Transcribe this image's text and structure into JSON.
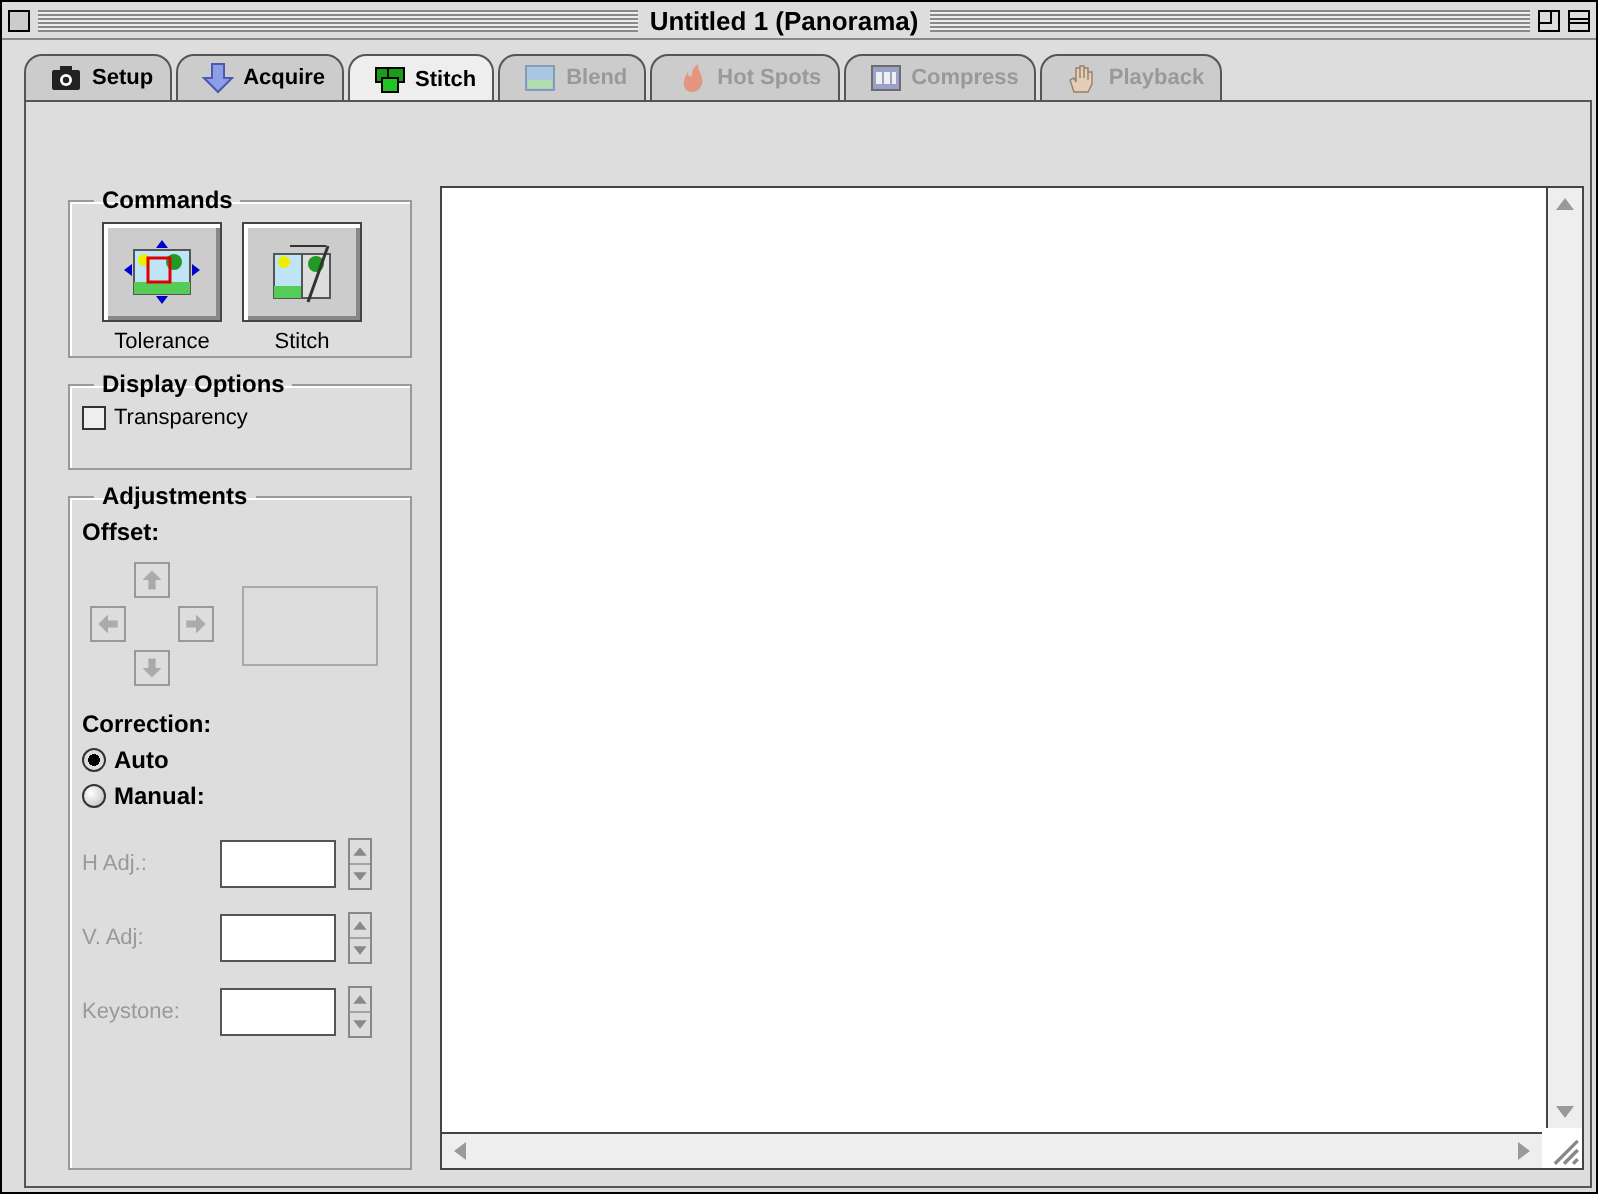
{
  "window": {
    "title": "Untitled 1 (Panorama)"
  },
  "tabs": [
    {
      "label": "Setup",
      "selected": false,
      "disabled": false
    },
    {
      "label": "Acquire",
      "selected": false,
      "disabled": false
    },
    {
      "label": "Stitch",
      "selected": true,
      "disabled": false
    },
    {
      "label": "Blend",
      "selected": false,
      "disabled": true
    },
    {
      "label": "Hot Spots",
      "selected": false,
      "disabled": true
    },
    {
      "label": "Compress",
      "selected": false,
      "disabled": true
    },
    {
      "label": "Playback",
      "selected": false,
      "disabled": true
    }
  ],
  "commands": {
    "title": "Commands",
    "buttons": [
      {
        "label": "Tolerance"
      },
      {
        "label": "Stitch"
      }
    ]
  },
  "display_options": {
    "title": "Display Options",
    "checkboxes": [
      {
        "label": "Transparency",
        "checked": false
      }
    ]
  },
  "adjustments": {
    "title": "Adjustments",
    "offset_label": "Offset:",
    "offset_disabled": true,
    "correction_label": "Correction:",
    "radios": [
      {
        "label": "Auto",
        "selected": true
      },
      {
        "label": "Manual:",
        "selected": false
      }
    ],
    "fields": [
      {
        "label": "H Adj.:",
        "disabled": true
      },
      {
        "label": "V. Adj:",
        "disabled": true
      },
      {
        "label": "Keystone:",
        "disabled": true
      }
    ]
  }
}
